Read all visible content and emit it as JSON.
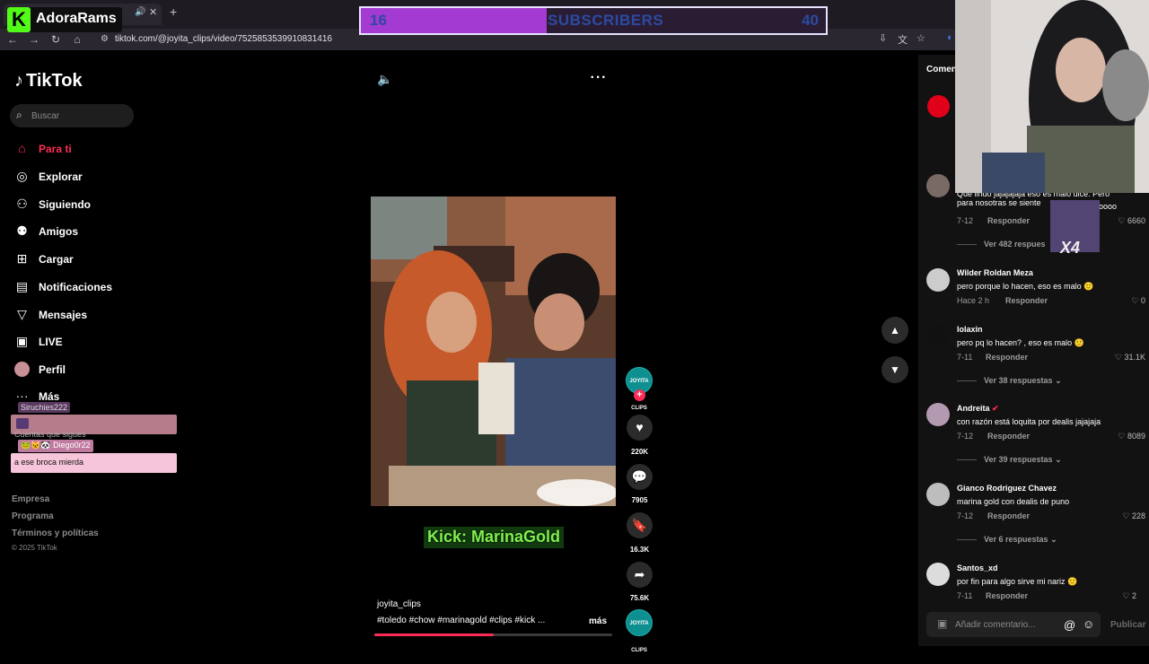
{
  "browser": {
    "url": "tiktok.com/@joyita_clips/video/7525853539910831416"
  },
  "stream_overlay": {
    "channel_name": "AdoraRams",
    "logo_letter": "K",
    "subscribers": {
      "current": "16",
      "label": "SUBSCRIBERS",
      "goal": "40",
      "progress": 0.4
    },
    "kick_handle": "Kick: MarinaGold",
    "chat": [
      {
        "user": "Siruchies222",
        "text": ""
      },
      {
        "user": "Diego0r22",
        "text": "a ese broca mierda"
      }
    ],
    "multiplier": "X4"
  },
  "sidebar": {
    "brand": "TikTok",
    "search_placeholder": "Buscar",
    "items": [
      {
        "label": "Para ti",
        "icon": "home-icon",
        "active": true
      },
      {
        "label": "Explorar",
        "icon": "compass-icon"
      },
      {
        "label": "Siguiendo",
        "icon": "following-icon"
      },
      {
        "label": "Amigos",
        "icon": "friends-icon"
      },
      {
        "label": "Cargar",
        "icon": "upload-icon"
      },
      {
        "label": "Notificaciones",
        "icon": "notification-icon"
      },
      {
        "label": "Mensajes",
        "icon": "message-icon"
      },
      {
        "label": "LIVE",
        "icon": "live-icon"
      },
      {
        "label": "Perfil",
        "icon": "profile-avatar-icon"
      },
      {
        "label": "Más",
        "icon": "more-icon"
      }
    ],
    "following_header": "Cuentas que sigues",
    "footer": [
      "Empresa",
      "Programa",
      "Términos y políticas"
    ],
    "copyright": "© 2025 TikTok"
  },
  "video": {
    "author": "joyita_clips",
    "hashtags": "#toledo #chow #marinagold #clips #kick ...",
    "more_label": "más",
    "progress": 0.5,
    "likes": "220K",
    "comments": "7905",
    "saves": "16.3K",
    "shares": "75.6K",
    "avatar_text": "JOYITA CLIPS"
  },
  "comments_panel": {
    "title": "Comen",
    "comments": [
      {
        "name": "",
        "text": "Que lindo jajajajaja eso es malo dice. Pero para nosotras se siente",
        "text_tail": "oooo",
        "date": "7-12",
        "reply": "Responder",
        "likes": "6660",
        "replies": "Ver 482 respues"
      },
      {
        "name": "Wilder Roldan Meza",
        "text": "pero porque lo hacen, eso es malo 🙂",
        "date": "Hace 2 h",
        "reply": "Responder",
        "likes": "0"
      },
      {
        "name": "lolaxin",
        "text": "pero pq lo hacen? , eso es malo 🙂",
        "date": "7-11",
        "reply": "Responder",
        "likes": "31.1K",
        "replies": "Ver 38 respuestas"
      },
      {
        "name": "Andreita",
        "verified": "✔",
        "text": "con razón está loquita por dealis jajajaja",
        "date": "7-12",
        "reply": "Responder",
        "likes": "8089",
        "replies": "Ver 39 respuestas"
      },
      {
        "name": "Gianco Rodriguez Chavez",
        "text": "marina gold con dealis de puno",
        "date": "7-12",
        "reply": "Responder",
        "likes": "228",
        "replies": "Ver 6 respuestas"
      },
      {
        "name": "Santos_xd",
        "text": "por fin para algo sirve mi nariz 🙂",
        "date": "7-11",
        "reply": "Responder",
        "likes": "2"
      }
    ],
    "input_placeholder": "Añadir comentario...",
    "publish_label": "Publicar"
  }
}
